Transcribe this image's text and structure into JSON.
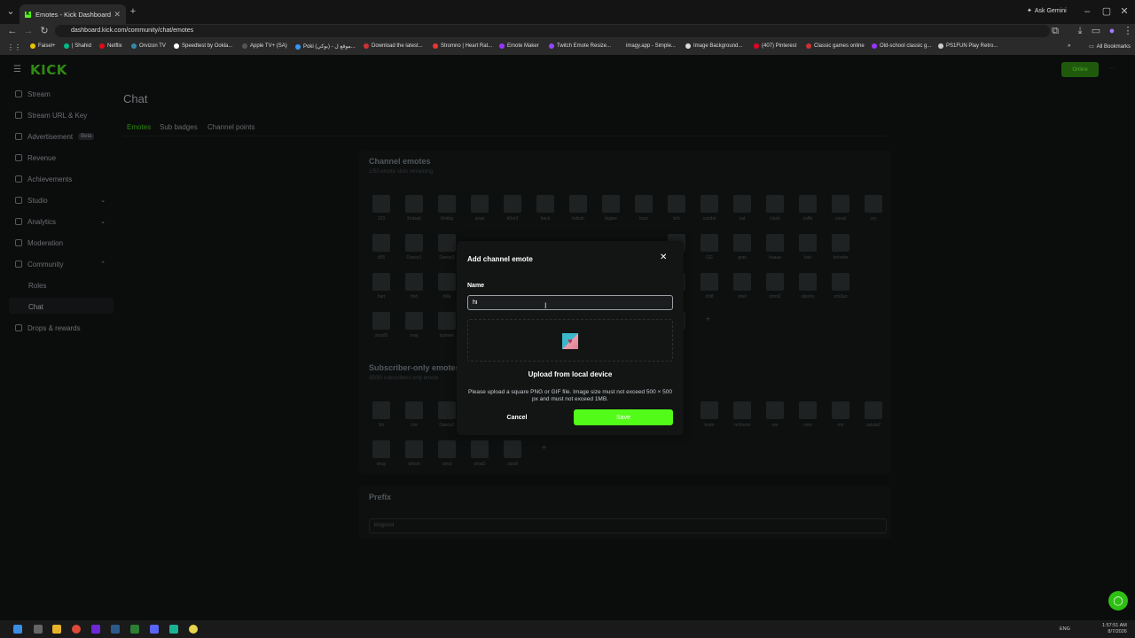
{
  "browser": {
    "tab_title": "Emotes - Kick Dashboard",
    "new_tab": "+",
    "ask_gemini": "Ask Gemini",
    "url": "dashboard.kick.com/community/chat/emotes",
    "bookmarks": [
      "Faisel+",
      "| Shahid",
      "Netflix",
      "Orvizon TV",
      "Speedtest by Ookla...",
      "Apple TV+ (SA)",
      "Poki (بوكي) - موقع ل...",
      "Download the latest...",
      "Stromno | Heart Rat...",
      "Emote Maker",
      "Twitch Emote Resize...",
      "imagy.app - Simple...",
      "Image Background...",
      "(407) Pinterest",
      "Classic games online",
      "Old-school classic g...",
      "PS1FUN Play Retro..."
    ],
    "all_bookmarks": "All Bookmarks"
  },
  "app": {
    "logo": "KICK",
    "online_label": "Online",
    "page_title": "Chat",
    "nav": {
      "stream": "Stream",
      "stream_url_key": "Stream URL & Key",
      "advertisement": "Advertisement",
      "beta": "Beta",
      "revenue": "Revenue",
      "achievements": "Achievements",
      "studio": "Studio",
      "analytics": "Analytics",
      "moderation": "Moderation",
      "community": "Community",
      "roles": "Roles",
      "chat": "Chat",
      "drops_rewards": "Drops & rewards"
    },
    "subtabs": {
      "emotes": "Emotes",
      "sub_badges": "Sub badges",
      "channel_points": "Channel points"
    },
    "channel_emotes": {
      "title": "Channel emotes",
      "subtitle": "1/50 emote slots remaining",
      "row1": [
        "123",
        "3mlaah",
        "6mtbg",
        "asaa",
        "b5or2",
        "back",
        "bdzah",
        "bigtee",
        "bum",
        "brb",
        "candel",
        "cat",
        "clash",
        "coffe",
        "cooal",
        "cry"
      ],
      "row2": [
        "d55",
        "Dance1",
        "Dance2",
        "",
        "",
        "",
        "",
        "",
        "",
        "flash",
        "GG",
        "gnts",
        "haaaa",
        "hah",
        "hehehe"
      ],
      "row3": [
        "hart",
        "hbd",
        "hilla",
        "",
        "",
        "",
        "",
        "",
        "",
        "shd",
        "shl8",
        "shet",
        "shmt2",
        "slipshy",
        "sm3an"
      ],
      "row4": [
        "smail5",
        "snaj",
        "tasheer",
        "",
        "",
        "",
        "",
        "",
        "",
        "znstuin"
      ]
    },
    "subscriber_emotes": {
      "title": "Subscriber-only emotes",
      "subtitle": "35/50 subscribers only emote",
      "row1": [
        "3m",
        "clor",
        "Dance2",
        "",
        "",
        "",
        "",
        "",
        "",
        "",
        "kratn",
        "m3moni",
        "nar",
        "nem",
        "rml",
        "salute2"
      ],
      "row2": [
        "shay",
        "tshtsh",
        "what",
        "what2",
        "zbsdl"
      ]
    },
    "prefix": {
      "title": "Prefix",
      "value": "kingsool"
    }
  },
  "modal": {
    "title": "Add channel emote",
    "name_label": "Name",
    "name_value": "hi",
    "upload_label": "Upload from local device",
    "upload_help": "Please upload a square PNG or GIF file. Image size must not exceed 500 × 500 px and must not exceed 1MB.",
    "cancel": "Cancel",
    "save": "Save"
  },
  "taskbar": {
    "lang": "ENG",
    "time": "1:57:51 AM",
    "date": "8/7/2026"
  },
  "colors": {
    "accent": "#53fc18",
    "background": "#0b0c0c",
    "modal": "#131515"
  }
}
